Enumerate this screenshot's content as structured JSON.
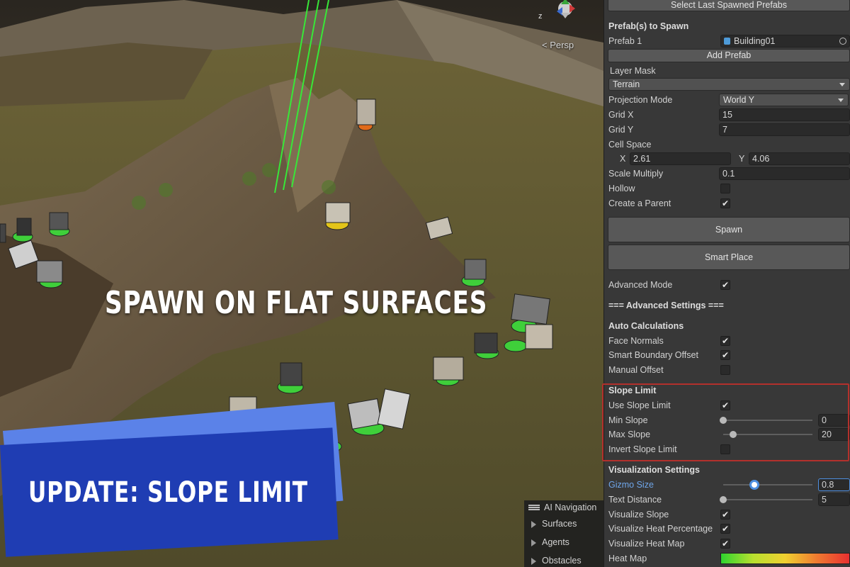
{
  "scene": {
    "headline": "SPAWN ON FLAT SURFACES",
    "banner": "UPDATE: SLOPE LIMIT",
    "view_mode": "< Persp",
    "gizmo_axis": "z",
    "ai_navigation": {
      "title": "AI Navigation",
      "items": [
        "Surfaces",
        "Agents",
        "Obstacles"
      ]
    }
  },
  "inspector": {
    "select_last_button": "Select Last Spawned Prefabs",
    "prefabs_header": "Prefab(s) to Spawn",
    "prefab1_label": "Prefab 1",
    "prefab1_value": "Building01",
    "add_prefab_button": "Add Prefab",
    "layer_mask_label": "Layer Mask",
    "layer_mask_value": "Terrain",
    "projection_mode_label": "Projection Mode",
    "projection_mode_value": "World Y",
    "grid_x_label": "Grid X",
    "grid_x_value": "15",
    "grid_y_label": "Grid Y",
    "grid_y_value": "7",
    "cell_space_label": "Cell Space",
    "cell_x_label": "X",
    "cell_x_value": "2.61",
    "cell_y_label": "Y",
    "cell_y_value": "4.06",
    "scale_multiply_label": "Scale Multiply",
    "scale_multiply_value": "0.1",
    "hollow_label": "Hollow",
    "hollow_checked": false,
    "create_parent_label": "Create a Parent",
    "create_parent_checked": true,
    "spawn_button": "Spawn",
    "smart_place_button": "Smart Place",
    "advanced_mode_label": "Advanced Mode",
    "advanced_mode_checked": true,
    "advanced_settings_header": "=== Advanced Settings ===",
    "auto_calc_header": "Auto Calculations",
    "face_normals_label": "Face Normals",
    "face_normals_checked": true,
    "smart_boundary_label": "Smart Boundary Offset",
    "smart_boundary_checked": true,
    "manual_offset_label": "Manual Offset",
    "manual_offset_checked": false,
    "slope_limit_header": "Slope Limit",
    "use_slope_limit_label": "Use Slope Limit",
    "use_slope_limit_checked": true,
    "min_slope_label": "Min Slope",
    "min_slope_value": "0",
    "min_slope_level": 0.0,
    "max_slope_label": "Max Slope",
    "max_slope_value": "20",
    "max_slope_level": 0.11,
    "invert_slope_label": "Invert Slope Limit",
    "invert_slope_checked": false,
    "visualization_header": "Visualization Settings",
    "gizmo_size_label": "Gizmo Size",
    "gizmo_size_value": "0.8",
    "gizmo_size_level": 0.35,
    "text_distance_label": "Text Distance",
    "text_distance_value": "5",
    "text_distance_level": 0.0,
    "visualize_slope_label": "Visualize Slope",
    "visualize_slope_checked": true,
    "visualize_heat_pct_label": "Visualize Heat Percentage",
    "visualize_heat_pct_checked": true,
    "visualize_heat_map_label": "Visualize Heat Map",
    "visualize_heat_map_checked": true,
    "heat_map_label": "Heat Map",
    "colors": {
      "accent_blue": "#4d8fe0",
      "highlight_red": "#b3302c",
      "banner_blue": "#1f3db3"
    }
  }
}
